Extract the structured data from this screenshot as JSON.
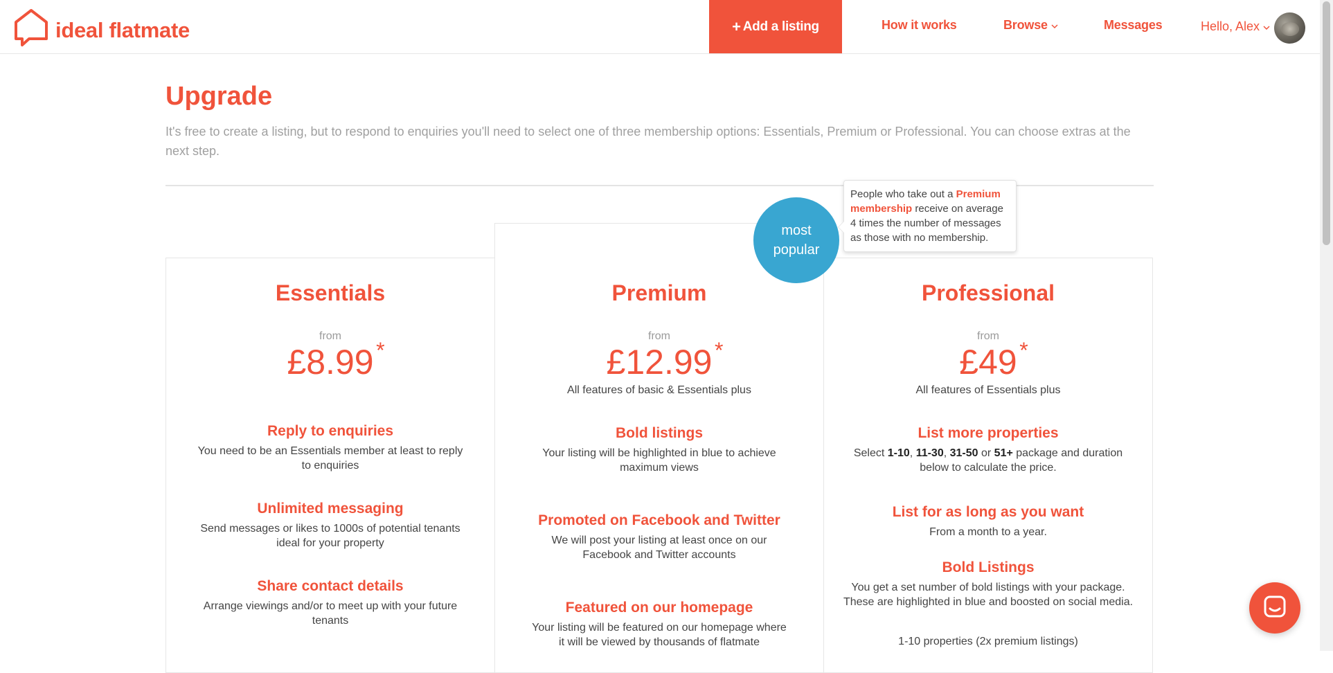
{
  "header": {
    "logo_text": "ideal flatmate",
    "add_listing": "Add a listing",
    "nav": {
      "how_it_works": "How it works",
      "browse": "Browse",
      "messages": "Messages"
    },
    "greeting": "Hello, Alex"
  },
  "page": {
    "title": "Upgrade",
    "intro": "It's free to create a listing, but to respond to enquiries you'll need to select one of three membership options: Essentials, Premium or Professional. You can choose extras at the next step."
  },
  "badge": {
    "line1": "most",
    "line2": "popular"
  },
  "tooltip": {
    "before": "People who take out a ",
    "highlight": "Premium membership",
    "after": " receive on average 4 times the number of messages as those with no membership."
  },
  "plans": {
    "essentials": {
      "name": "Essentials",
      "from": "from",
      "price": "£8.99",
      "asterisk": "*",
      "features": [
        {
          "title": "Reply to enquiries",
          "text": "You need to be an Essentials member at least to reply to enquiries"
        },
        {
          "title": "Unlimited messaging",
          "text": "Send messages or likes to 1000s of potential tenants ideal for your property"
        },
        {
          "title": "Share contact details",
          "text": "Arrange viewings and/or to meet up with your future tenants"
        }
      ]
    },
    "premium": {
      "name": "Premium",
      "from": "from",
      "price": "£12.99",
      "asterisk": "*",
      "subline": "All features of basic & Essentials plus",
      "features": [
        {
          "title": "Bold listings",
          "text": "Your listing will be highlighted in blue to achieve maximum views"
        },
        {
          "title": "Promoted on Facebook and Twitter",
          "text": "We will post your listing at least once on our Facebook and Twitter accounts"
        },
        {
          "title": "Featured on our homepage",
          "text": "Your listing will be featured on our homepage where it will be viewed by thousands of flatmate"
        }
      ]
    },
    "professional": {
      "name": "Professional",
      "from": "from",
      "price": "£49",
      "asterisk": "*",
      "subline": "All features of Essentials plus",
      "features": [
        {
          "title": "List more properties",
          "text_parts": [
            "Select ",
            "1-10",
            ", ",
            "11-30",
            ", ",
            "31-50",
            " or ",
            "51+",
            " package and duration below to calculate the price."
          ]
        },
        {
          "title": "List for as long as you want",
          "text": "From a month to a year."
        },
        {
          "title": "Bold Listings",
          "text": "You get a set number of bold listings with your package. These are highlighted in blue and boosted on social media."
        }
      ],
      "extra_line": "1-10 properties (2x premium listings)"
    }
  },
  "colors": {
    "brand": "#f0533b",
    "badge": "#39a6d1",
    "muted": "#a0a0a0"
  },
  "icons": {
    "logo": "house-speech-icon",
    "add": "plus-icon",
    "dropdown": "chevron-down-icon",
    "chat": "chat-icon"
  }
}
